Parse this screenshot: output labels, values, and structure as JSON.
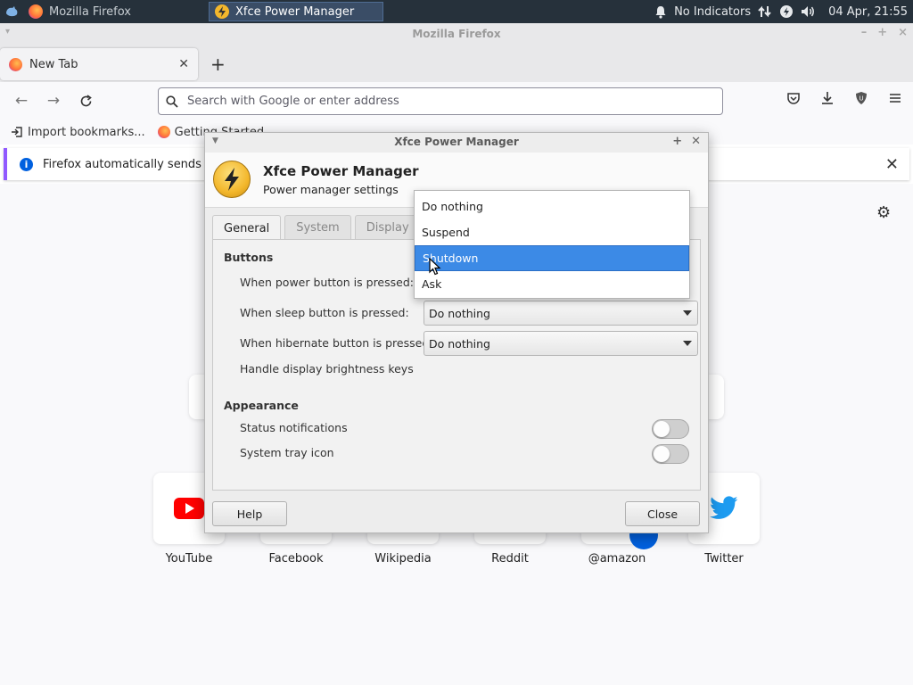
{
  "panel": {
    "task1": "Mozilla Firefox",
    "task2": "Xfce Power Manager",
    "indicators": "No Indicators",
    "clock": "04 Apr, 21:55"
  },
  "firefox": {
    "window_title": "Mozilla Firefox",
    "tab_title": "New Tab",
    "url_placeholder": "Search with Google or enter address",
    "bookmarks": [
      "Import bookmarks...",
      "Getting Started"
    ],
    "notice": "Firefox automatically sends some",
    "shortcuts": [
      "YouTube",
      "Facebook",
      "Wikipedia",
      "Reddit",
      "@amazon",
      "Twitter"
    ]
  },
  "dialog": {
    "title": "Xfce Power Manager",
    "heading": "Xfce Power Manager",
    "subheading": "Power manager settings",
    "tabs": [
      "General",
      "System",
      "Display"
    ],
    "buttons_section": "Buttons",
    "power_label": "When power button is pressed:",
    "sleep_label": "When sleep button is pressed:",
    "sleep_value": "Do nothing",
    "hibernate_label": "When hibernate button is pressed:",
    "hibernate_value": "Do nothing",
    "brightness_label": "Handle display brightness keys",
    "appearance_section": "Appearance",
    "status_label": "Status notifications",
    "tray_label": "System tray icon",
    "help": "Help",
    "close": "Close",
    "status_notifications_on": false,
    "system_tray_on": false
  },
  "dropdown": {
    "options": [
      "Do nothing",
      "Suspend",
      "Shutdown",
      "Ask"
    ],
    "highlighted": "Shutdown"
  },
  "colors": {
    "panel_bg": "#26313b",
    "selection": "#3c8ae6",
    "firefox_accent": "#9059ff"
  }
}
